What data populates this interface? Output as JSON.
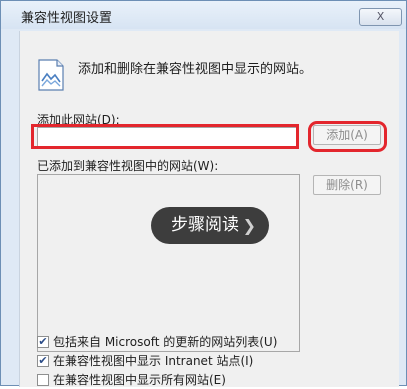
{
  "dialog": {
    "title": "兼容性视图设置",
    "close_label": "X",
    "intro_text": "添加和删除在兼容性视图中显示的网站。",
    "add_site_label": "添加此网站(D):",
    "add_site_value": "",
    "add_button_label": "添加(A)",
    "sites_list_label": "已添加到兼容性视图中的网站(W):",
    "remove_button_label": "删除(R)",
    "overlay_button_label": "步骤阅读",
    "checkboxes": [
      {
        "label": "包括来自 Microsoft 的更新的网站列表(U)",
        "checked": true
      },
      {
        "label": "在兼容性视图中显示 Intranet 站点(I)",
        "checked": true
      },
      {
        "label": "在兼容性视图中显示所有网站(E)",
        "checked": false
      }
    ]
  },
  "colors": {
    "highlight_red": "#e3262d",
    "overlay_pill": "#3d3d3d"
  }
}
